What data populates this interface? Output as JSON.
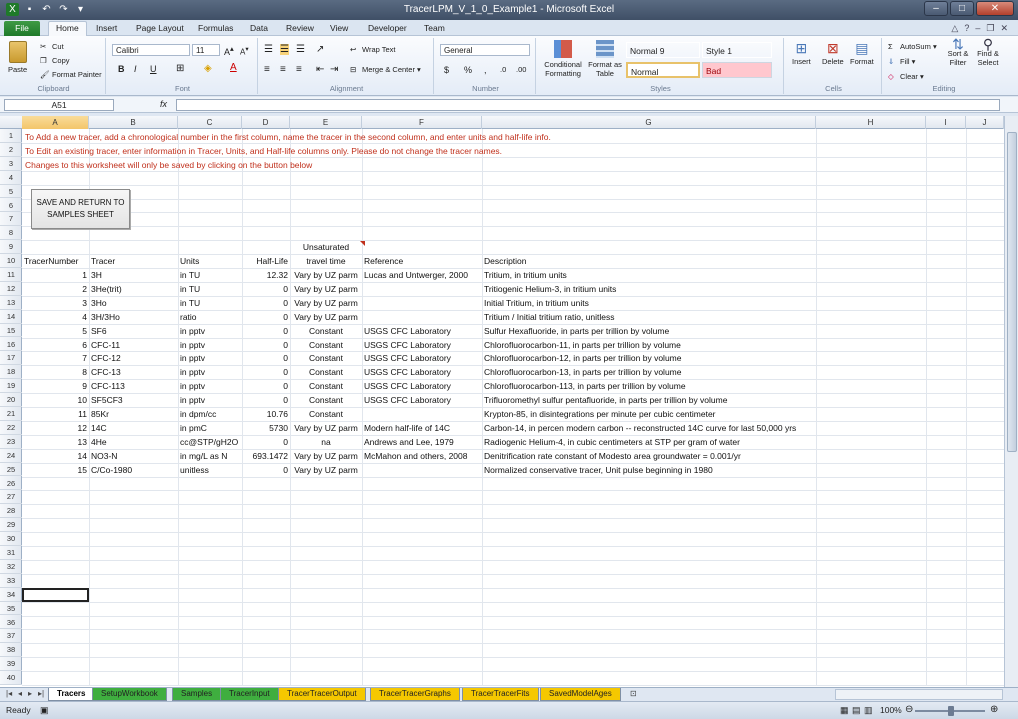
{
  "window": {
    "title": "TracerLPM_V_1_0_Example1 - Microsoft Excel"
  },
  "tabs": [
    "File",
    "Home",
    "Insert",
    "Page Layout",
    "Formulas",
    "Data",
    "Review",
    "View",
    "Developer",
    "Team"
  ],
  "ribbon": {
    "clipboard": {
      "paste": "Paste",
      "cut": "Cut",
      "copy": "Copy",
      "format_painter": "Format Painter",
      "label": "Clipboard"
    },
    "font": {
      "name": "Calibri",
      "size": "11",
      "label": "Font",
      "bold": "B",
      "italic": "I",
      "underline": "U"
    },
    "alignment": {
      "wrap": "Wrap Text",
      "merge": "Merge & Center",
      "label": "Alignment"
    },
    "number": {
      "format": "General",
      "label": "Number",
      "currency": "$",
      "percent": "%",
      "comma": ","
    },
    "styles": {
      "conditional": "Conditional Formatting",
      "format_table": "Format as Table",
      "normal9": "Normal 9",
      "style1": "Style 1",
      "normal": "Normal",
      "bad": "Bad",
      "label": "Styles"
    },
    "cells": {
      "insert": "Insert",
      "delete": "Delete",
      "format": "Format",
      "label": "Cells"
    },
    "editing": {
      "autosum": "AutoSum",
      "fill": "Fill",
      "clear": "Clear",
      "sort": "Sort & Filter",
      "find": "Find & Select",
      "label": "Editing"
    }
  },
  "formula_bar": {
    "name_box": "A51",
    "fx": "fx",
    "value": ""
  },
  "columns": [
    "A",
    "B",
    "C",
    "D",
    "E",
    "F",
    "G",
    "H",
    "I",
    "J"
  ],
  "instructions": [
    "To Add a new tracer, add a chronological number in the first column, name the tracer in the second column, and enter units and half-life info.",
    "To Edit an existing tracer, enter information in Tracer, Units, and Half-life columns only. Please do not change the tracer names.",
    "Changes to this worksheet will only be saved by clicking on the button below"
  ],
  "save_button": "SAVE AND RETURN TO SAMPLES SHEET",
  "headers": {
    "num": "TracerNumber",
    "tracer": "Tracer",
    "units": "Units",
    "halflife": "Half-Life",
    "uz1": "Unsaturated",
    "uz2": "travel time",
    "ref": "Reference",
    "desc": "Description"
  },
  "rows": [
    {
      "n": "1",
      "t": "3H",
      "u": "in TU",
      "h": "12.32",
      "e": "Vary by UZ parm",
      "r": "Lucas and Untwerger, 2000",
      "d": "Tritium, in tritium units"
    },
    {
      "n": "2",
      "t": "3He(trit)",
      "u": "in TU",
      "h": "0",
      "e": "Vary by UZ parm",
      "r": "",
      "d": "Tritiogenic Helium-3, in tritium units"
    },
    {
      "n": "3",
      "t": "3Ho",
      "u": "in TU",
      "h": "0",
      "e": "Vary by UZ parm",
      "r": "",
      "d": "Initial Tritium, in tritium units"
    },
    {
      "n": "4",
      "t": "3H/3Ho",
      "u": "ratio",
      "h": "0",
      "e": "Vary by UZ parm",
      "r": "",
      "d": "Tritium / Initial tritium ratio, unitless"
    },
    {
      "n": "5",
      "t": "SF6",
      "u": "in pptv",
      "h": "0",
      "e": "Constant",
      "r": "USGS CFC Laboratory",
      "d": "Sulfur Hexafluoride, in parts per trillion by volume"
    },
    {
      "n": "6",
      "t": "CFC-11",
      "u": "in pptv",
      "h": "0",
      "e": "Constant",
      "r": "USGS CFC Laboratory",
      "d": "Chlorofluorocarbon-11, in parts per trillion by volume"
    },
    {
      "n": "7",
      "t": "CFC-12",
      "u": "in pptv",
      "h": "0",
      "e": "Constant",
      "r": "USGS CFC Laboratory",
      "d": "Chlorofluorocarbon-12, in parts per trillion by volume"
    },
    {
      "n": "8",
      "t": "CFC-13",
      "u": "in pptv",
      "h": "0",
      "e": "Constant",
      "r": "USGS CFC Laboratory",
      "d": "Chlorofluorocarbon-13, in parts per trillion by volume"
    },
    {
      "n": "9",
      "t": "CFC-113",
      "u": "in pptv",
      "h": "0",
      "e": "Constant",
      "r": "USGS CFC Laboratory",
      "d": "Chlorofluorocarbon-113, in parts per trillion by volume"
    },
    {
      "n": "10",
      "t": "SF5CF3",
      "u": "in pptv",
      "h": "0",
      "e": "Constant",
      "r": "USGS CFC Laboratory",
      "d": "Trifluoromethyl sulfur pentafluoride, in parts per trillion by volume"
    },
    {
      "n": "11",
      "t": "85Kr",
      "u": "in dpm/cc",
      "h": "10.76",
      "e": "Constant",
      "r": "",
      "d": "Krypton-85, in disintegrations per minute per cubic centimeter"
    },
    {
      "n": "12",
      "t": "14C",
      "u": "in pmC",
      "h": "5730",
      "e": "Vary by UZ parm",
      "r": "Modern half-life of 14C",
      "d": "Carbon-14, in percen modern carbon -- reconstructed 14C curve for last 50,000 yrs"
    },
    {
      "n": "13",
      "t": "4He",
      "u": "cc@STP/gH2O",
      "h": "0",
      "e": "na",
      "r": "Andrews and Lee, 1979",
      "d": "Radiogenic Helium-4, in cubic centimeters at STP per gram of water"
    },
    {
      "n": "14",
      "t": "NO3-N",
      "u": "in mg/L as N",
      "h": "693.1472",
      "e": "Vary by UZ parm",
      "r": "McMahon and others, 2008",
      "d": "Denitrification rate constant of Modesto area groundwater = 0.001/yr"
    },
    {
      "n": "15",
      "t": "C/Co-1980",
      "u": "unitless",
      "h": "0",
      "e": "Vary by UZ parm",
      "r": "",
      "d": "Normalized conservative tracer, Unit pulse beginning in 1980"
    }
  ],
  "sheet_tabs": [
    {
      "name": "Tracers",
      "color": "#ffffff"
    },
    {
      "name": "SetupWorkbook",
      "color": "#3fae3f"
    },
    {
      "name": "Samples",
      "color": "#3fae3f"
    },
    {
      "name": "TracerInput",
      "color": "#3fae3f"
    },
    {
      "name": "TracerTracerOutput",
      "color": "#f5c800"
    },
    {
      "name": "TracerTracerGraphs",
      "color": "#f5c800"
    },
    {
      "name": "TracerTracerFits",
      "color": "#f5c800"
    },
    {
      "name": "SavedModelAges",
      "color": "#f5c800"
    }
  ],
  "status": {
    "ready": "Ready",
    "zoom": "100%"
  },
  "colors": {
    "accent_red": "#c0301c",
    "file_green": "#1f7a2a",
    "selected_header": "#f3c56a"
  }
}
